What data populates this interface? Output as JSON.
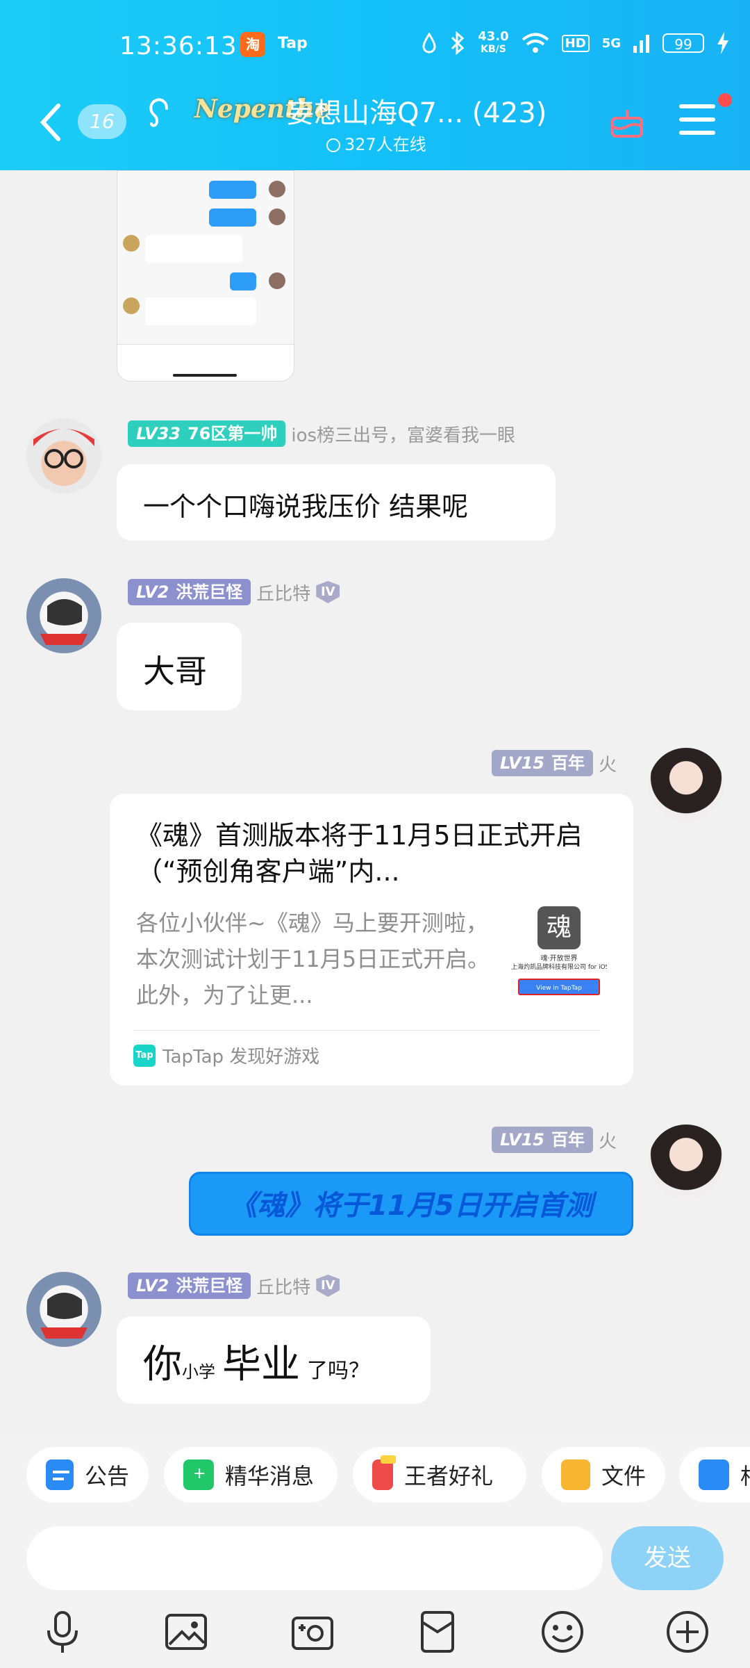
{
  "status_bar": {
    "time": "13:36:13",
    "tap_label": "Tap",
    "speed_value": "43.0",
    "speed_unit": "KB/S",
    "hd": "HD",
    "network": "5G",
    "battery": "99"
  },
  "header": {
    "unread_count": "16",
    "group_logo_text": "Nepenthe",
    "group_name": "妄想山海Q7... (423)",
    "online_text": "327人在线"
  },
  "messages": [
    {
      "badge_level": "LV33",
      "badge_title": "76区第一帅",
      "extra": "ios榜三出号，富婆看我一眼",
      "text": "一个个口嗨说我压价 结果呢"
    },
    {
      "badge_level": "LV2",
      "badge_title": "洪荒巨怪",
      "extra": "丘比特",
      "rank_icon": "IV",
      "text": "大哥"
    },
    {
      "badge_level": "LV15",
      "badge_title": "百年",
      "extra": "火",
      "card": {
        "title": "《魂》首测版本将于11月5日正式开启（“预创角客户端”内...",
        "desc": "各位小伙伴~《魂》马上要开测啦，本次测试计划于11月5日正式开启。此外，为了让更...",
        "thumb_title": "魂",
        "thumb_line1": "魂·开放世界",
        "thumb_line2": "上海灼凯品牌科技有限公司 for iOS",
        "thumb_button": "View in TapTap",
        "source_logo": "Tap",
        "source": "TapTap 发现好游戏"
      }
    },
    {
      "badge_level": "LV15",
      "badge_title": "百年",
      "extra": "火",
      "text": "《魂》将于11月5日开启首测"
    },
    {
      "badge_level": "LV2",
      "badge_title": "洪荒巨怪",
      "extra": "丘比特",
      "rank_icon": "IV",
      "text_a": "你",
      "text_b": "小学",
      "text_c": "毕业",
      "text_d": "了吗？"
    }
  ],
  "quick_actions": [
    {
      "label": "公告",
      "icon": "announcement-icon"
    },
    {
      "label": "精华消息",
      "icon": "highlight-message-icon"
    },
    {
      "label": "王者好礼",
      "icon": "gift-icon"
    },
    {
      "label": "文件",
      "icon": "folder-icon"
    },
    {
      "label": "相",
      "icon": "album-icon"
    }
  ],
  "input": {
    "placeholder": "",
    "send_label": "发送"
  },
  "toolbar": [
    "microphone-icon",
    "image-icon",
    "camera-icon",
    "red-packet-icon",
    "emoji-icon",
    "plus-icon"
  ],
  "colors": {
    "header_gradient_start": "#1ccdf7",
    "header_gradient_end": "#19b3f5",
    "badge_teal": "#2ecfbd",
    "badge_purple": "#8c90cf",
    "badge_grey": "#a3a8c8",
    "send_button": "#8fd2f8",
    "blue_bubble": "#1a99f7"
  }
}
